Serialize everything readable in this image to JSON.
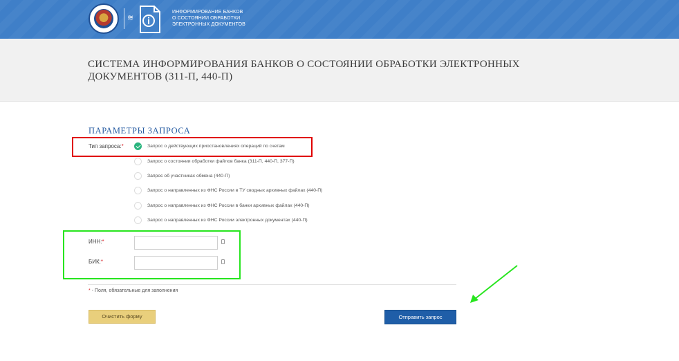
{
  "header": {
    "logo_lines": [
      "ИНФОРМИРОВАНИЕ БАНКОВ",
      "О СОСТОЯНИИ ОБРАБОТКИ",
      "ЭЛЕКТРОННЫХ ДОКУМЕНТОВ"
    ],
    "color": "#3f7fc8"
  },
  "page": {
    "title_line1": "СИСТЕМА ИНФОРМИРОВАНИЯ БАНКОВ О СОСТОЯНИИ ОБРАБОТКИ ЭЛЕКТРОННЫХ",
    "title_line2": "ДОКУМЕНТОВ (311-П, 440-П)"
  },
  "form": {
    "section_title": "ПАРАМЕТРЫ ЗАПРОСА",
    "request_type_label": "Тип запроса:",
    "required_mark": "*",
    "options": [
      {
        "label": "Запрос о действующих приостановлениях операций по счетам",
        "checked": true
      },
      {
        "label": "Запрос о состоянии обработки файлов банка (311-П, 440-П, 377-П)",
        "checked": false
      },
      {
        "label": "Запрос об участниках обмена (440-П)",
        "checked": false
      },
      {
        "label": "Запрос о направленных из ФНС России в ТУ сводных архивных файлах (440-П)",
        "checked": false
      },
      {
        "label": "Запрос о направленных из ФНС России в банки архивных файлах (440-П)",
        "checked": false
      },
      {
        "label": "Запрос о направленных из ФНС России электронных документах (440-П)",
        "checked": false
      }
    ],
    "inn_label": "ИНН:",
    "inn_value": "",
    "bik_label": "БИК:",
    "bik_value": "",
    "note_text": " - Поля, обязательные для заполнения",
    "clear_button": "Очистить форму",
    "submit_button": "Отправить запрос"
  },
  "colors": {
    "accent_blue": "#2a5ea3",
    "check_green": "#2bb57f",
    "clear_button": "#e9cf7c",
    "submit_button": "#1f5ea8",
    "annotation_red": "#e00000",
    "annotation_green": "#27e51e"
  }
}
